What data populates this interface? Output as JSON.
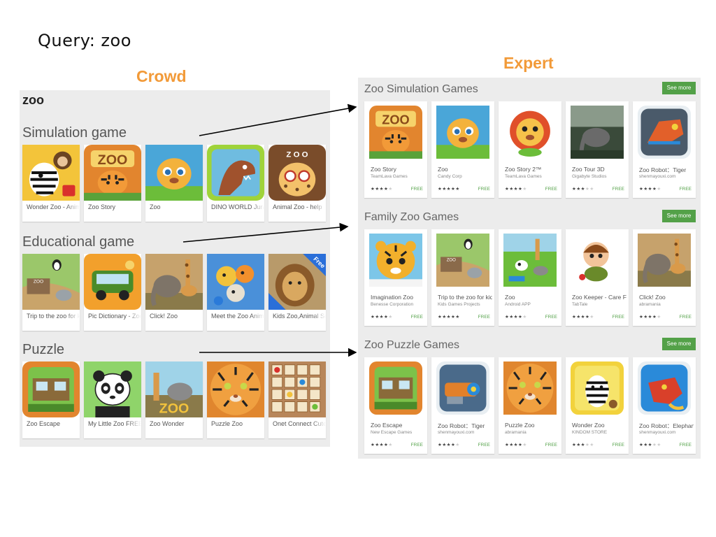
{
  "query": "Query: zoo",
  "labels": {
    "crowd": "Crowd",
    "expert": "Expert"
  },
  "crowd": {
    "title": "zoo",
    "sections": [
      {
        "heading": "Simulation game",
        "apps": [
          {
            "name": "Wonder Zoo - Animal rescue",
            "icon": "zebra-monkey"
          },
          {
            "name": "Zoo Story",
            "icon": "zoo-tiger"
          },
          {
            "name": "Zoo",
            "icon": "lion-cub"
          },
          {
            "name": "DINO WORLD Jurassic",
            "icon": "dinosaur"
          },
          {
            "name": "Animal Zoo - help",
            "icon": "leopard-glasses"
          }
        ]
      },
      {
        "heading": "Educational game",
        "apps": [
          {
            "name": "Trip to the zoo for kids",
            "icon": "zoo-map"
          },
          {
            "name": "Pic Dictionary - Zoo",
            "icon": "safari-jeep"
          },
          {
            "name": "Click! Zoo",
            "icon": "elephant-giraffe"
          },
          {
            "name": "Meet the Zoo Animals",
            "icon": "cartoon-animals"
          },
          {
            "name": "Kids Zoo,Animal Sounds",
            "icon": "lion-free"
          }
        ]
      },
      {
        "heading": "Puzzle",
        "apps": [
          {
            "name": "Zoo Escape",
            "icon": "zoo-escape"
          },
          {
            "name": "My Little Zoo FREE",
            "icon": "panda"
          },
          {
            "name": "Zoo Wonder",
            "icon": "zoo-wonder"
          },
          {
            "name": "Puzzle Zoo",
            "icon": "tiger-face"
          },
          {
            "name": "Onet Connect Cute",
            "icon": "onet-grid"
          }
        ]
      }
    ]
  },
  "expert": {
    "see_more": "See more",
    "sections": [
      {
        "heading": "Zoo Simulation Games",
        "apps": [
          {
            "name": "Zoo Story",
            "developer": "TeamLava Games",
            "stars": 4,
            "price": "FREE",
            "icon": "zoo-tiger"
          },
          {
            "name": "Zoo",
            "developer": "Candy Corp",
            "stars": 4.5,
            "price": "FREE",
            "icon": "lion-cub"
          },
          {
            "name": "Zoo Story 2™",
            "developer": "TeamLava Games",
            "stars": 4,
            "price": "FREE",
            "icon": "cartoon-lion"
          },
          {
            "name": "Zoo Tour 3D",
            "developer": "Gigabyte Studios",
            "stars": 3,
            "price": "FREE",
            "icon": "zoo-tour"
          },
          {
            "name": "Zoo Robot：Tiger",
            "developer": "shenmayouxi.com",
            "stars": 3.5,
            "price": "FREE",
            "icon": "robot-tiger"
          }
        ]
      },
      {
        "heading": "Family Zoo Games",
        "apps": [
          {
            "name": "Imagination Zoo",
            "developer": "Benesse Corporation",
            "stars": 3.5,
            "price": "FREE",
            "icon": "cartoon-tiger"
          },
          {
            "name": "Trip to the zoo for kids",
            "developer": "Kids Games Projects",
            "stars": 4.5,
            "price": "FREE",
            "icon": "zoo-map"
          },
          {
            "name": "Zoo",
            "developer": "Android APP",
            "stars": 3.5,
            "price": "FREE",
            "icon": "zoo-3d"
          },
          {
            "name": "Zoo Keeper - Care For",
            "developer": "TabTale",
            "stars": 3.5,
            "price": "FREE",
            "icon": "zoo-keeper"
          },
          {
            "name": "Click! Zoo",
            "developer": "abramania",
            "stars": 3.5,
            "price": "FREE",
            "icon": "elephant-giraffe"
          }
        ]
      },
      {
        "heading": "Zoo Puzzle Games",
        "apps": [
          {
            "name": "Zoo Escape",
            "developer": "New Escape Games",
            "stars": 3.5,
            "price": "FREE",
            "icon": "zoo-escape"
          },
          {
            "name": "Zoo Robot：Tiger",
            "developer": "shenmayouxi.com",
            "stars": 3.5,
            "price": "FREE",
            "icon": "robot-tiger-2"
          },
          {
            "name": "Puzzle Zoo",
            "developer": "abramania",
            "stars": 4,
            "price": "FREE",
            "icon": "tiger-face"
          },
          {
            "name": "Wonder Zoo",
            "developer": "KINDOM STORE",
            "stars": 3,
            "price": "FREE",
            "icon": "zebra-yellow"
          },
          {
            "name": "Zoo Robot：Elephant",
            "developer": "shenmayouxi.com",
            "stars": 3,
            "price": "FREE",
            "icon": "robot-elephant"
          }
        ]
      }
    ]
  },
  "colors": {
    "label_orange": "#f29a38",
    "see_more_green": "#53a148",
    "free_green": "#53a148",
    "panel_gray": "#ececec"
  }
}
